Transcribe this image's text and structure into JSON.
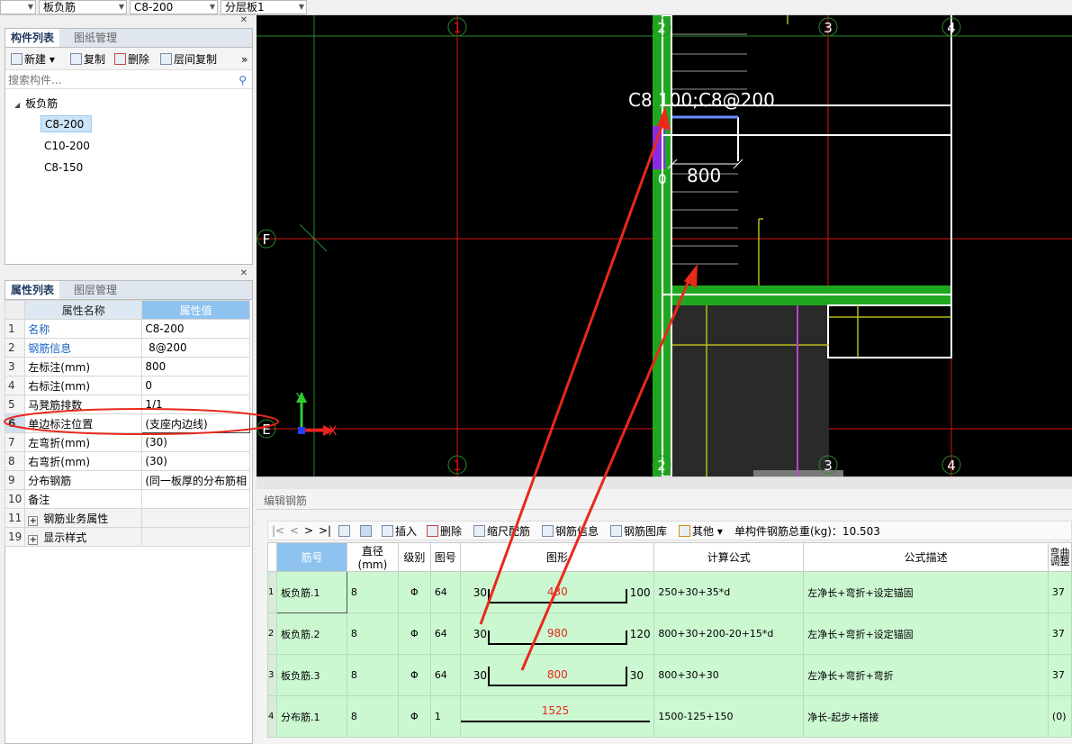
{
  "toolbar": {
    "combo1": "",
    "combo2": "板负筋",
    "combo3": "C8-200",
    "combo4": "分层板1"
  },
  "component_panel": {
    "tabs": [
      "构件列表",
      "图纸管理"
    ],
    "buttons": {
      "new": "新建",
      "copy": "复制",
      "delete": "删除",
      "floor_copy": "层间复制"
    },
    "search_placeholder": "搜索构件...",
    "tree_root": "板负筋",
    "tree_items": [
      "C8-200",
      "C10-200",
      "C8-150"
    ],
    "selected_item": "C8-200"
  },
  "property_panel": {
    "tabs": [
      "属性列表",
      "图层管理"
    ],
    "headers": {
      "name": "属性名称",
      "value": "属性值"
    },
    "rows": [
      {
        "num": "1",
        "name": "名称",
        "value": "C8-200"
      },
      {
        "num": "2",
        "name": "钢筋信息",
        "value": " 8@200"
      },
      {
        "num": "3",
        "name": "左标注(mm)",
        "value": "800"
      },
      {
        "num": "4",
        "name": "右标注(mm)",
        "value": "0"
      },
      {
        "num": "5",
        "name": "马凳筋排数",
        "value": "1/1"
      },
      {
        "num": "6",
        "name": "单边标注位置",
        "value": "(支座内边线)"
      },
      {
        "num": "7",
        "name": "左弯折(mm)",
        "value": "(30)"
      },
      {
        "num": "8",
        "name": "右弯折(mm)",
        "value": "(30)"
      },
      {
        "num": "9",
        "name": "分布钢筋",
        "value": "(同一板厚的分布筋相"
      },
      {
        "num": "10",
        "name": "备注",
        "value": ""
      },
      {
        "num": "11",
        "name": "钢筋业务属性",
        "value": ""
      },
      {
        "num": "19",
        "name": "显示样式",
        "value": ""
      }
    ]
  },
  "cad": {
    "axis_labels_top": [
      "1",
      "2",
      "3",
      "4"
    ],
    "axis_labels_bottom": [
      "1",
      "2",
      "3",
      "4"
    ],
    "row_labels": [
      "F",
      "E"
    ],
    "rebar_label": "C8 100;C8@200",
    "dimension": "800",
    "dim_zero": "0",
    "ucs_y": "Y",
    "ucs_x": "X"
  },
  "editor": {
    "title": "编辑钢筋",
    "nav": [
      "|<",
      "<",
      ">",
      ">|"
    ],
    "buttons": {
      "insert": "插入",
      "delete": "删除",
      "scale": "缩尺配筋",
      "info": "钢筋信息",
      "library": "钢筋图库",
      "other": "其他"
    },
    "total_weight": "单构件钢筋总重(kg)：10.503",
    "columns": [
      "筋号",
      "直径(mm)",
      "级别",
      "图号",
      "图形",
      "计算公式",
      "公式描述",
      "弯曲调整"
    ],
    "rows": [
      {
        "idx": "1",
        "name": "板负筋.1",
        "dia": "8",
        "grade": "Φ",
        "fig": "64",
        "left": "30",
        "len": "430",
        "right": "100",
        "formula": "250+30+35*d",
        "desc": "左净长+弯折+设定锚固",
        "adj": "37"
      },
      {
        "idx": "2",
        "name": "板负筋.2",
        "dia": "8",
        "grade": "Φ",
        "fig": "64",
        "left": "30",
        "len": "980",
        "right": "120",
        "formula": "800+30+200-20+15*d",
        "desc": "左净长+弯折+设定锚固",
        "adj": "37"
      },
      {
        "idx": "3",
        "name": "板负筋.3",
        "dia": "8",
        "grade": "Φ",
        "fig": "64",
        "left": "30",
        "len": "800",
        "right": "30",
        "formula": "800+30+30",
        "desc": "左净长+弯折+弯折",
        "adj": "37"
      },
      {
        "idx": "4",
        "name": "分布筋.1",
        "dia": "8",
        "grade": "Φ",
        "fig": "1",
        "left": "",
        "len": "1525",
        "right": "",
        "formula": "1500-125+150",
        "desc": "净长-起步+搭接",
        "adj": "(0)"
      }
    ]
  },
  "colors": {
    "annotation_red": "#e8291c",
    "selected_header": "#8fc3ef",
    "row_green": "#cbf7d1"
  }
}
